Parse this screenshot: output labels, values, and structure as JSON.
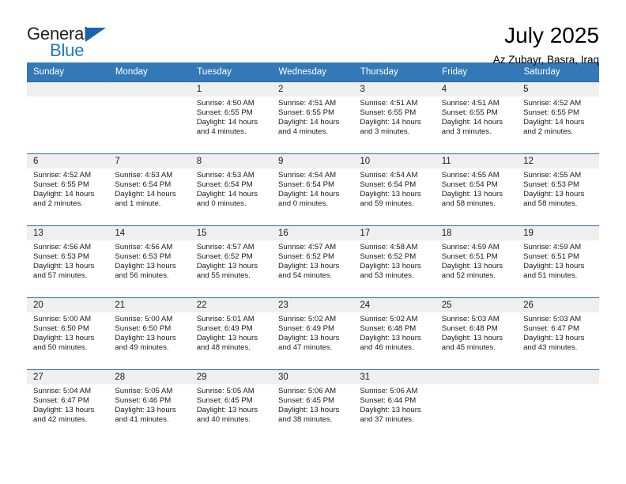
{
  "logo": {
    "word_one": "General",
    "word_two": "Blue",
    "triangle_icon": "blue-triangle-icon",
    "colors": {
      "general": "#231f20",
      "blue": "#1f7ac0",
      "triangle": "#1665ad"
    }
  },
  "header": {
    "title": "July 2025",
    "subtitle": "Az Zubayr, Basra, Iraq"
  },
  "theme": {
    "header_bg": "#3379b8",
    "header_text": "#ffffff",
    "row_rule": "#2a6aa8",
    "daynum_band": "#efefef",
    "page_bg": "#ffffff"
  },
  "calendar": {
    "weekday_headers": [
      "Sunday",
      "Monday",
      "Tuesday",
      "Wednesday",
      "Thursday",
      "Friday",
      "Saturday"
    ],
    "weeks": [
      [
        {
          "day": "",
          "lines": []
        },
        {
          "day": "",
          "lines": []
        },
        {
          "day": "1",
          "lines": [
            "Sunrise: 4:50 AM",
            "Sunset: 6:55 PM",
            "Daylight: 14 hours",
            "and 4 minutes."
          ]
        },
        {
          "day": "2",
          "lines": [
            "Sunrise: 4:51 AM",
            "Sunset: 6:55 PM",
            "Daylight: 14 hours",
            "and 4 minutes."
          ]
        },
        {
          "day": "3",
          "lines": [
            "Sunrise: 4:51 AM",
            "Sunset: 6:55 PM",
            "Daylight: 14 hours",
            "and 3 minutes."
          ]
        },
        {
          "day": "4",
          "lines": [
            "Sunrise: 4:51 AM",
            "Sunset: 6:55 PM",
            "Daylight: 14 hours",
            "and 3 minutes."
          ]
        },
        {
          "day": "5",
          "lines": [
            "Sunrise: 4:52 AM",
            "Sunset: 6:55 PM",
            "Daylight: 14 hours",
            "and 2 minutes."
          ]
        }
      ],
      [
        {
          "day": "6",
          "lines": [
            "Sunrise: 4:52 AM",
            "Sunset: 6:55 PM",
            "Daylight: 14 hours",
            "and 2 minutes."
          ]
        },
        {
          "day": "7",
          "lines": [
            "Sunrise: 4:53 AM",
            "Sunset: 6:54 PM",
            "Daylight: 14 hours",
            "and 1 minute."
          ]
        },
        {
          "day": "8",
          "lines": [
            "Sunrise: 4:53 AM",
            "Sunset: 6:54 PM",
            "Daylight: 14 hours",
            "and 0 minutes."
          ]
        },
        {
          "day": "9",
          "lines": [
            "Sunrise: 4:54 AM",
            "Sunset: 6:54 PM",
            "Daylight: 14 hours",
            "and 0 minutes."
          ]
        },
        {
          "day": "10",
          "lines": [
            "Sunrise: 4:54 AM",
            "Sunset: 6:54 PM",
            "Daylight: 13 hours",
            "and 59 minutes."
          ]
        },
        {
          "day": "11",
          "lines": [
            "Sunrise: 4:55 AM",
            "Sunset: 6:54 PM",
            "Daylight: 13 hours",
            "and 58 minutes."
          ]
        },
        {
          "day": "12",
          "lines": [
            "Sunrise: 4:55 AM",
            "Sunset: 6:53 PM",
            "Daylight: 13 hours",
            "and 58 minutes."
          ]
        }
      ],
      [
        {
          "day": "13",
          "lines": [
            "Sunrise: 4:56 AM",
            "Sunset: 6:53 PM",
            "Daylight: 13 hours",
            "and 57 minutes."
          ]
        },
        {
          "day": "14",
          "lines": [
            "Sunrise: 4:56 AM",
            "Sunset: 6:53 PM",
            "Daylight: 13 hours",
            "and 56 minutes."
          ]
        },
        {
          "day": "15",
          "lines": [
            "Sunrise: 4:57 AM",
            "Sunset: 6:52 PM",
            "Daylight: 13 hours",
            "and 55 minutes."
          ]
        },
        {
          "day": "16",
          "lines": [
            "Sunrise: 4:57 AM",
            "Sunset: 6:52 PM",
            "Daylight: 13 hours",
            "and 54 minutes."
          ]
        },
        {
          "day": "17",
          "lines": [
            "Sunrise: 4:58 AM",
            "Sunset: 6:52 PM",
            "Daylight: 13 hours",
            "and 53 minutes."
          ]
        },
        {
          "day": "18",
          "lines": [
            "Sunrise: 4:59 AM",
            "Sunset: 6:51 PM",
            "Daylight: 13 hours",
            "and 52 minutes."
          ]
        },
        {
          "day": "19",
          "lines": [
            "Sunrise: 4:59 AM",
            "Sunset: 6:51 PM",
            "Daylight: 13 hours",
            "and 51 minutes."
          ]
        }
      ],
      [
        {
          "day": "20",
          "lines": [
            "Sunrise: 5:00 AM",
            "Sunset: 6:50 PM",
            "Daylight: 13 hours",
            "and 50 minutes."
          ]
        },
        {
          "day": "21",
          "lines": [
            "Sunrise: 5:00 AM",
            "Sunset: 6:50 PM",
            "Daylight: 13 hours",
            "and 49 minutes."
          ]
        },
        {
          "day": "22",
          "lines": [
            "Sunrise: 5:01 AM",
            "Sunset: 6:49 PM",
            "Daylight: 13 hours",
            "and 48 minutes."
          ]
        },
        {
          "day": "23",
          "lines": [
            "Sunrise: 5:02 AM",
            "Sunset: 6:49 PM",
            "Daylight: 13 hours",
            "and 47 minutes."
          ]
        },
        {
          "day": "24",
          "lines": [
            "Sunrise: 5:02 AM",
            "Sunset: 6:48 PM",
            "Daylight: 13 hours",
            "and 46 minutes."
          ]
        },
        {
          "day": "25",
          "lines": [
            "Sunrise: 5:03 AM",
            "Sunset: 6:48 PM",
            "Daylight: 13 hours",
            "and 45 minutes."
          ]
        },
        {
          "day": "26",
          "lines": [
            "Sunrise: 5:03 AM",
            "Sunset: 6:47 PM",
            "Daylight: 13 hours",
            "and 43 minutes."
          ]
        }
      ],
      [
        {
          "day": "27",
          "lines": [
            "Sunrise: 5:04 AM",
            "Sunset: 6:47 PM",
            "Daylight: 13 hours",
            "and 42 minutes."
          ]
        },
        {
          "day": "28",
          "lines": [
            "Sunrise: 5:05 AM",
            "Sunset: 6:46 PM",
            "Daylight: 13 hours",
            "and 41 minutes."
          ]
        },
        {
          "day": "29",
          "lines": [
            "Sunrise: 5:05 AM",
            "Sunset: 6:45 PM",
            "Daylight: 13 hours",
            "and 40 minutes."
          ]
        },
        {
          "day": "30",
          "lines": [
            "Sunrise: 5:06 AM",
            "Sunset: 6:45 PM",
            "Daylight: 13 hours",
            "and 38 minutes."
          ]
        },
        {
          "day": "31",
          "lines": [
            "Sunrise: 5:06 AM",
            "Sunset: 6:44 PM",
            "Daylight: 13 hours",
            "and 37 minutes."
          ]
        },
        {
          "day": "",
          "lines": []
        },
        {
          "day": "",
          "lines": []
        }
      ]
    ]
  }
}
